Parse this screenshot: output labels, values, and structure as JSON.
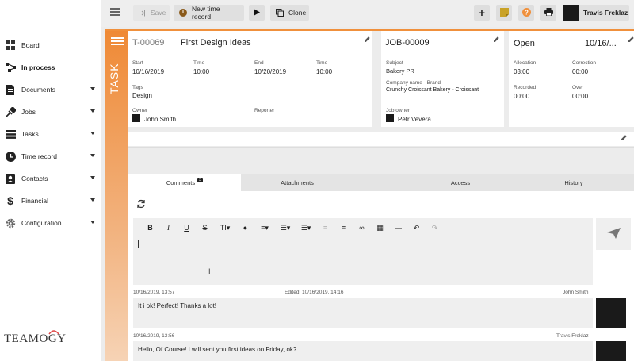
{
  "sidebar": {
    "items": [
      {
        "label": "Board",
        "icon": "board-icon",
        "has_caret": false
      },
      {
        "label": "In process",
        "icon": "process-icon",
        "has_caret": false
      },
      {
        "label": "Documents",
        "icon": "document-icon",
        "has_caret": true
      },
      {
        "label": "Jobs",
        "icon": "jobs-icon",
        "has_caret": true
      },
      {
        "label": "Tasks",
        "icon": "tasks-icon",
        "has_caret": true
      },
      {
        "label": "Time record",
        "icon": "clock-icon",
        "has_caret": true
      },
      {
        "label": "Contacts",
        "icon": "contacts-icon",
        "has_caret": true
      },
      {
        "label": "Financial",
        "icon": "dollar-icon",
        "has_caret": true
      },
      {
        "label": "Configuration",
        "icon": "gear-icon",
        "has_caret": true
      }
    ],
    "logo_text": "TEAMOGY"
  },
  "toolbar": {
    "save_label": "Save",
    "new_time_record_label": "New time record",
    "clone_label": "Clone",
    "user_name": "Travis Freklaz"
  },
  "task": {
    "strip_label": "TASK",
    "id": "T-00069",
    "title": "First Design Ideas",
    "start_label": "Start",
    "start_date": "10/16/2019",
    "start_time_label": "Time",
    "start_time": "10:00",
    "end_label": "End",
    "end_date": "10/20/2019",
    "end_time_label": "Time",
    "end_time": "10:00",
    "tags_label": "Tags",
    "tags_value": "Design",
    "owner_label": "Owner",
    "owner_name": "John Smith",
    "reporter_label": "Reporter"
  },
  "job": {
    "id": "JOB-00009",
    "subject_label": "Subject",
    "subject_value": "Bakery PR",
    "company_label": "Company name - Brand",
    "company_value": "Crunchy Croissant Bakery - Croissant",
    "owner_label": "Job owner",
    "owner_name": "Petr Vevera"
  },
  "status": {
    "state": "Open",
    "date": "10/16/...",
    "allocation_label": "Allocation",
    "allocation_value": "03:00",
    "correction_label": "Correction",
    "correction_value": "00:00",
    "recorded_label": "Recorded",
    "recorded_value": "00:00",
    "over_label": "Over",
    "over_value": "00:00"
  },
  "tabs": [
    {
      "label": "Comments",
      "badge": "3"
    },
    {
      "label": "Attachments"
    },
    {
      "label": "Access"
    },
    {
      "label": "History"
    }
  ],
  "comments": [
    {
      "timestamp": "10/16/2019, 13:57",
      "edited": "Edited: 10/16/2019, 14:16",
      "author": "John Smith",
      "text": "It i ok! Perfect! Thanks a lot!"
    },
    {
      "timestamp": "10/16/2019, 13:56",
      "edited": "",
      "author": "Travis Freklaz",
      "text": "Hello, Of Course! I will sent you first ideas on Friday, ok?"
    }
  ],
  "colors": {
    "accent": "#ef8a36",
    "topbar": "#eeeeee"
  }
}
